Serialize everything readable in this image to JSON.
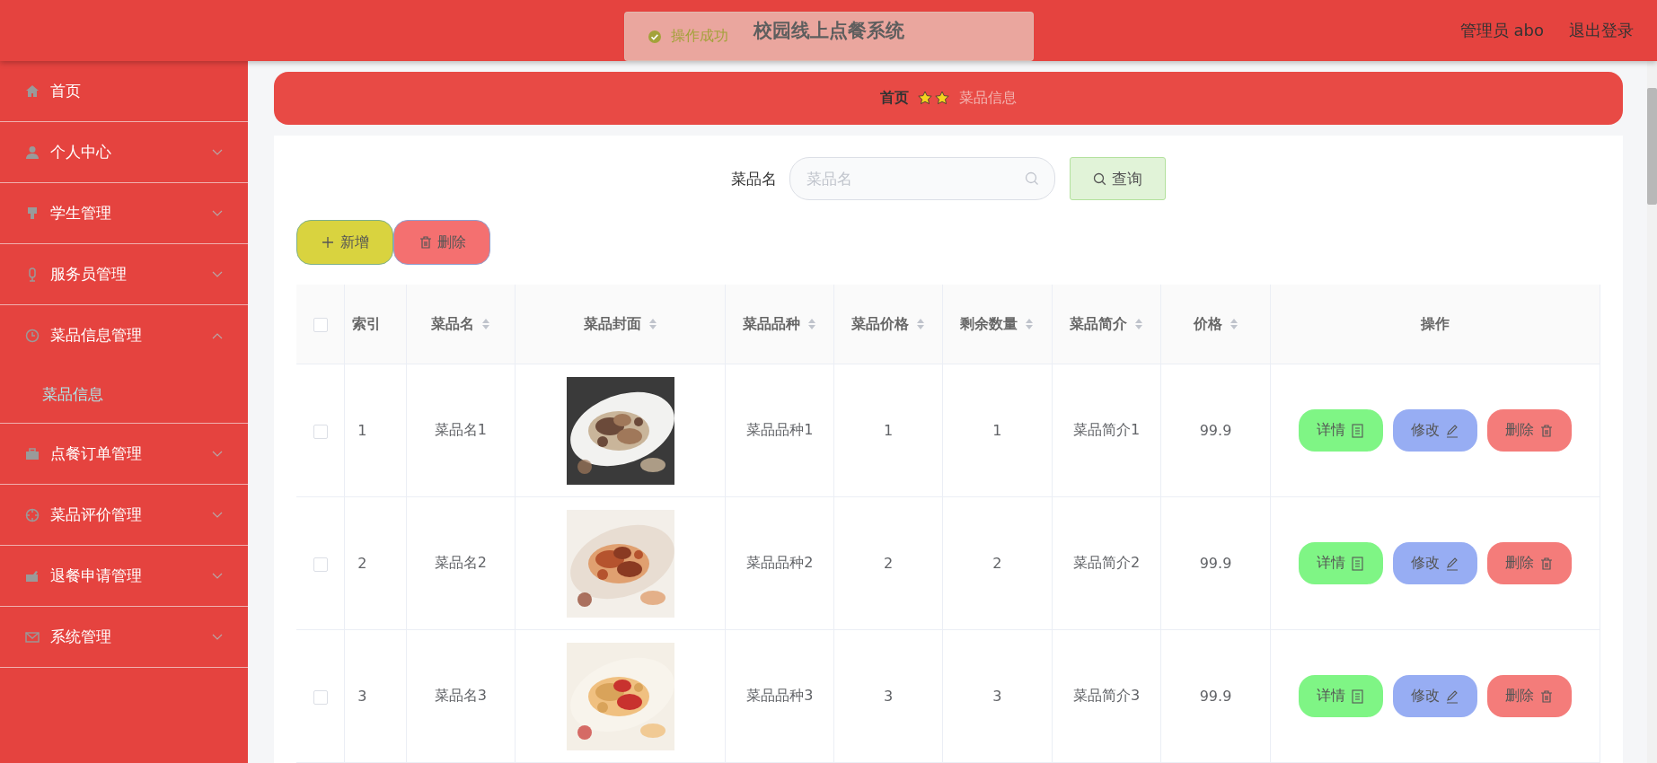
{
  "header": {
    "title": "校园线上点餐系统",
    "user": "管理员 abo",
    "logout": "退出登录"
  },
  "toast": {
    "message": "操作成功"
  },
  "sidebar": {
    "items": [
      {
        "label": "首页",
        "kind": "link"
      },
      {
        "label": "个人中心",
        "kind": "menu",
        "expanded": false
      },
      {
        "label": "学生管理",
        "kind": "menu",
        "expanded": false
      },
      {
        "label": "服务员管理",
        "kind": "menu",
        "expanded": false
      },
      {
        "label": "菜品信息管理",
        "kind": "menu",
        "expanded": true,
        "children": [
          {
            "label": "菜品信息",
            "selected": true
          }
        ]
      },
      {
        "label": "点餐订单管理",
        "kind": "menu",
        "expanded": false
      },
      {
        "label": "菜品评价管理",
        "kind": "menu",
        "expanded": false
      },
      {
        "label": "退餐申请管理",
        "kind": "menu",
        "expanded": false
      },
      {
        "label": "系统管理",
        "kind": "menu",
        "expanded": false
      }
    ]
  },
  "breadcrumb": [
    "首页",
    "菜品信息"
  ],
  "search": {
    "label": "菜品名",
    "placeholder": "菜品名",
    "button": "查询"
  },
  "actions": [
    {
      "label": "新增",
      "kind": "add"
    },
    {
      "label": "删除",
      "kind": "delete"
    }
  ],
  "table": {
    "select_all": {
      "checked": false
    },
    "columns": [
      {
        "label": "索引",
        "sortable": false
      },
      {
        "label": "菜品名",
        "sortable": true
      },
      {
        "label": "菜品封面",
        "sortable": true
      },
      {
        "label": "菜品品种",
        "sortable": true
      },
      {
        "label": "菜品价格",
        "sortable": true
      },
      {
        "label": "剩余数量",
        "sortable": true
      },
      {
        "label": "菜品简介",
        "sortable": true
      },
      {
        "label": "价格",
        "sortable": true
      },
      {
        "label": "操作",
        "sortable": false
      }
    ],
    "rows": [
      {
        "checked": false,
        "cells": [
          "1",
          "菜品名1",
          {
            "kind": "picture"
          },
          "菜品品种1",
          "1",
          "1",
          "菜品简介1",
          "99.9",
          {
            "actions": [
              {
                "label": "详情",
                "kind": "detail"
              },
              {
                "label": "修改",
                "kind": "edit"
              },
              {
                "label": "删除",
                "kind": "delete"
              }
            ]
          }
        ]
      },
      {
        "checked": false,
        "cells": [
          "2",
          "菜品名2",
          {
            "kind": "picture"
          },
          "菜品品种2",
          "2",
          "2",
          "菜品简介2",
          "99.9",
          {
            "actions": [
              {
                "label": "详情",
                "kind": "detail"
              },
              {
                "label": "修改",
                "kind": "edit"
              },
              {
                "label": "删除",
                "kind": "delete"
              }
            ]
          }
        ]
      },
      {
        "checked": false,
        "cells": [
          "3",
          "菜品名3",
          {
            "kind": "picture"
          },
          "菜品品种3",
          "3",
          "3",
          "菜品简介3",
          "99.9",
          {
            "actions": [
              {
                "label": "详情",
                "kind": "detail"
              },
              {
                "label": "修改",
                "kind": "edit"
              },
              {
                "label": "删除",
                "kind": "delete"
              }
            ]
          }
        ]
      }
    ]
  }
}
